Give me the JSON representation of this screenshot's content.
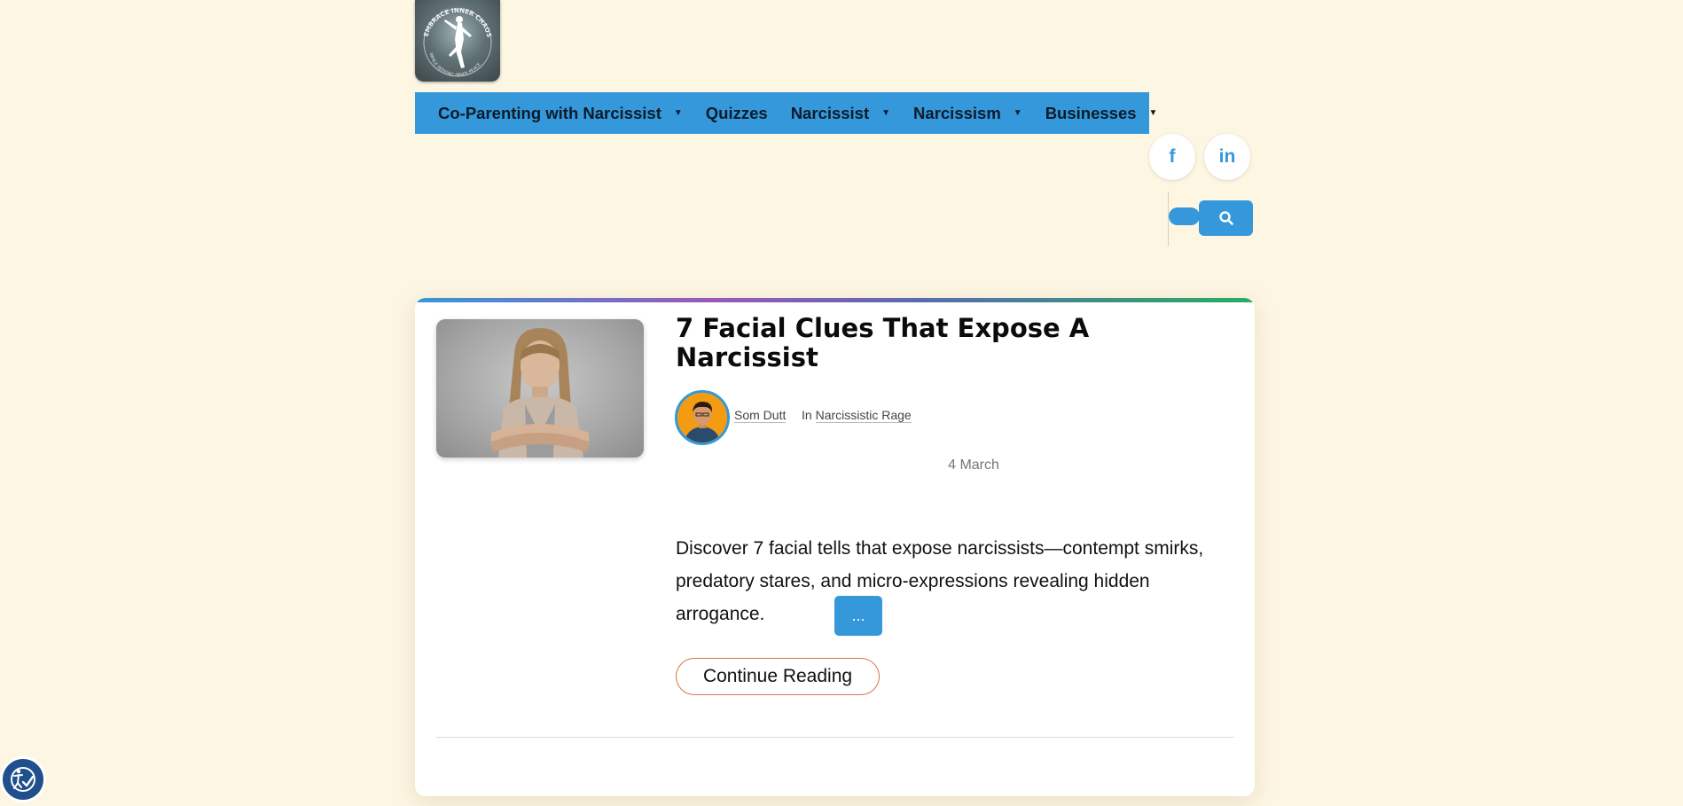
{
  "site": {
    "logo_text": "EMBRACE INNER CHAOS",
    "logo_subtext": "WHILE SEEKING INNER PEACE"
  },
  "nav": {
    "items": [
      {
        "label": "Co-Parenting with Narcissist",
        "has_dropdown": true
      },
      {
        "label": "Quizzes",
        "has_dropdown": false
      },
      {
        "label": "Narcissist",
        "has_dropdown": true
      },
      {
        "label": "Narcissism",
        "has_dropdown": true
      },
      {
        "label": "Businesses",
        "has_dropdown": true
      }
    ]
  },
  "social": {
    "facebook_glyph": "f",
    "linkedin_glyph": "in"
  },
  "search": {
    "placeholder": "",
    "button_icon": "search-icon"
  },
  "post": {
    "title": "7 Facial Clues That Expose A Narcissist",
    "author": "Som Dutt",
    "category_prefix": "In ",
    "category": "Narcissistic Rage",
    "date": "4 March",
    "excerpt": "Discover 7 facial tells that expose narcissists—contempt smirks, predatory stares, and micro-expressions revealing hidden arrogance.",
    "more_label": "...",
    "continue_label": "Continue Reading"
  },
  "colors": {
    "accent": "#3498db",
    "background": "#fdf6e3",
    "button_border": "#d9744a"
  }
}
